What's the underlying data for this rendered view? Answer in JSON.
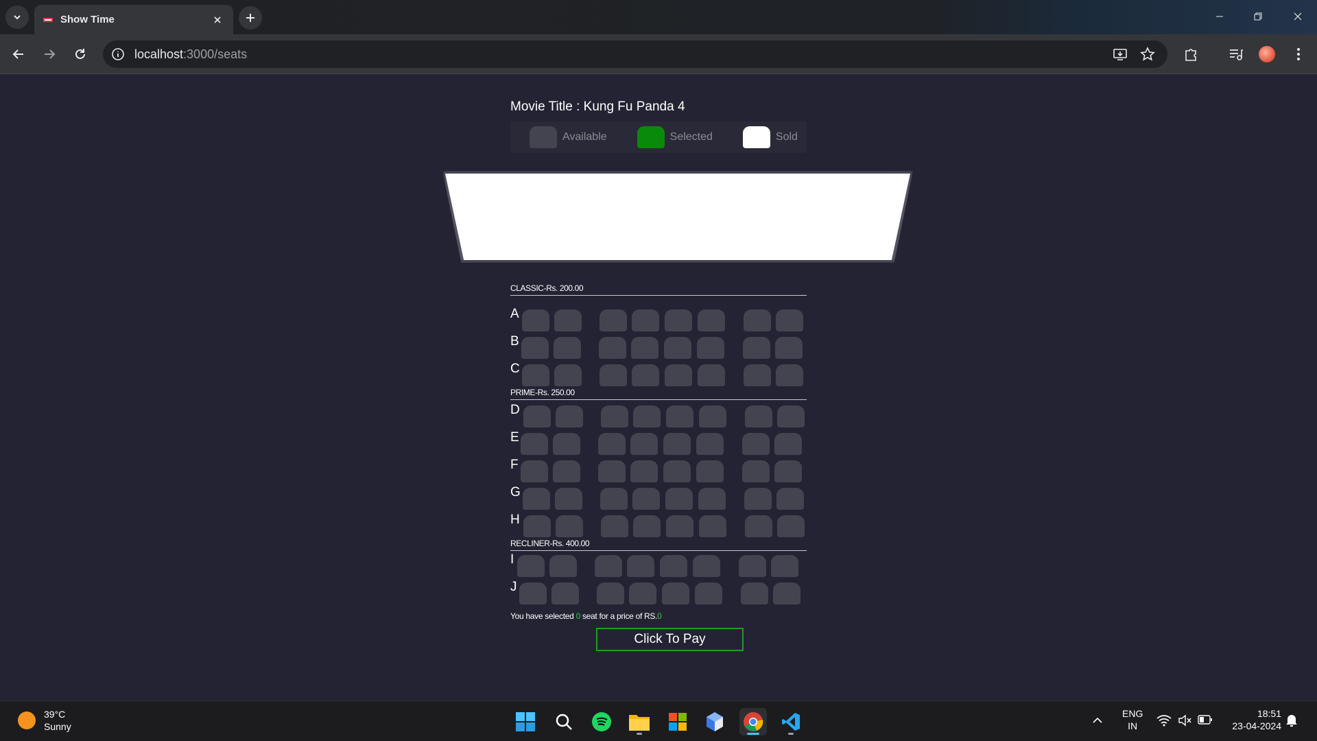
{
  "browser": {
    "tab_title": "Show Time",
    "url_host": "localhost",
    "url_path": ":3000/seats",
    "icons": [
      "tab-search-icon",
      "favicon-icon",
      "close-icon",
      "plus-icon",
      "minimize-icon",
      "restore-icon",
      "window-close-icon",
      "back-icon",
      "forward-icon",
      "reload-icon",
      "info-icon",
      "install-icon",
      "star-icon",
      "extensions-icon",
      "media-icon",
      "profile-avatar",
      "more-icon"
    ]
  },
  "page": {
    "movie_title": "Movie Title : Kung Fu Panda 4",
    "legend": [
      {
        "label": "Available",
        "color": "#444451"
      },
      {
        "label": "Selected",
        "color": "#0a8a0a"
      },
      {
        "label": "Sold",
        "color": "#ffffff"
      }
    ],
    "sections": [
      {
        "title": "CLASSIC-Rs. 200.00",
        "rows": [
          "A",
          "B",
          "C"
        ]
      },
      {
        "title": "PRIME-Rs. 250.00",
        "rows": [
          "D",
          "E",
          "F",
          "G",
          "H"
        ]
      },
      {
        "title": "RECLINER-Rs. 400.00",
        "rows": [
          "I",
          "J"
        ]
      }
    ],
    "seats_per_row": 8,
    "summary": {
      "prefix": "You have selected ",
      "count": "0",
      "middle": " seat for a price of RS.",
      "price": "0"
    },
    "pay_button": "Click To Pay"
  },
  "taskbar": {
    "temperature": "39°C",
    "condition": "Sunny",
    "lang_top": "ENG",
    "lang_bottom": "IN",
    "time": "18:51",
    "date": "23-04-2024",
    "apps": [
      "start-icon",
      "search-icon",
      "spotify-icon",
      "file-explorer-icon",
      "store-icon",
      "app-cube-icon",
      "chrome-icon",
      "vscode-icon"
    ]
  },
  "colors": {
    "page_bg": "#242333",
    "seat_available": "#444451",
    "seat_selected": "#0a8a0a",
    "seat_sold": "#ffffff",
    "pay_border": "#1e9e1e",
    "highlight": "#2ecc40"
  }
}
